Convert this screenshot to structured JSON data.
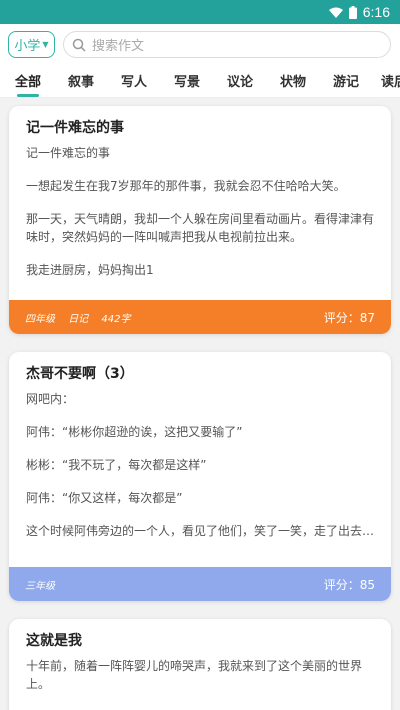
{
  "status": {
    "time": "6:16"
  },
  "header": {
    "grade": "小学",
    "search_placeholder": "搜索作文"
  },
  "tabs": [
    "全部",
    "叙事",
    "写人",
    "写景",
    "议论",
    "状物",
    "游记",
    "读后"
  ],
  "cards": [
    {
      "title": "记一件难忘的事",
      "paragraphs": [
        "记一件难忘的事",
        "一想起发生在我7岁那年的那件事，我就会忍不住哈哈大笑。",
        "那一天，天气晴朗，我却一个人躲在房间里看动画片。看得津津有味时，突然妈妈的一阵叫喊声把我从电视前拉出来。",
        "我走进厨房，妈妈掏出1"
      ],
      "meta": [
        "四年级",
        "日记",
        "442字"
      ],
      "score": "评分：87",
      "footer_color": "#f57f28"
    },
    {
      "title": "杰哥不要啊（3）",
      "paragraphs": [
        "网吧内：",
        "阿伟：“彬彬你超逊的诶，这把又要输了”",
        "彬彬：“我不玩了，每次都是这样”",
        "阿伟：“你又这样，每次都是”",
        "这个时候阿伟旁边的一个人，看见了他们，笑了一笑，走了出去…"
      ],
      "meta": [
        "三年级"
      ],
      "score": "评分：85",
      "footer_color": "#8fa9ec"
    },
    {
      "title": "这就是我",
      "paragraphs": [
        "十年前，随着一阵阵婴儿的啼哭声，我就来到了这个美丽的世界上。"
      ],
      "meta": [],
      "score": "",
      "footer_color": "#ffffff"
    }
  ]
}
